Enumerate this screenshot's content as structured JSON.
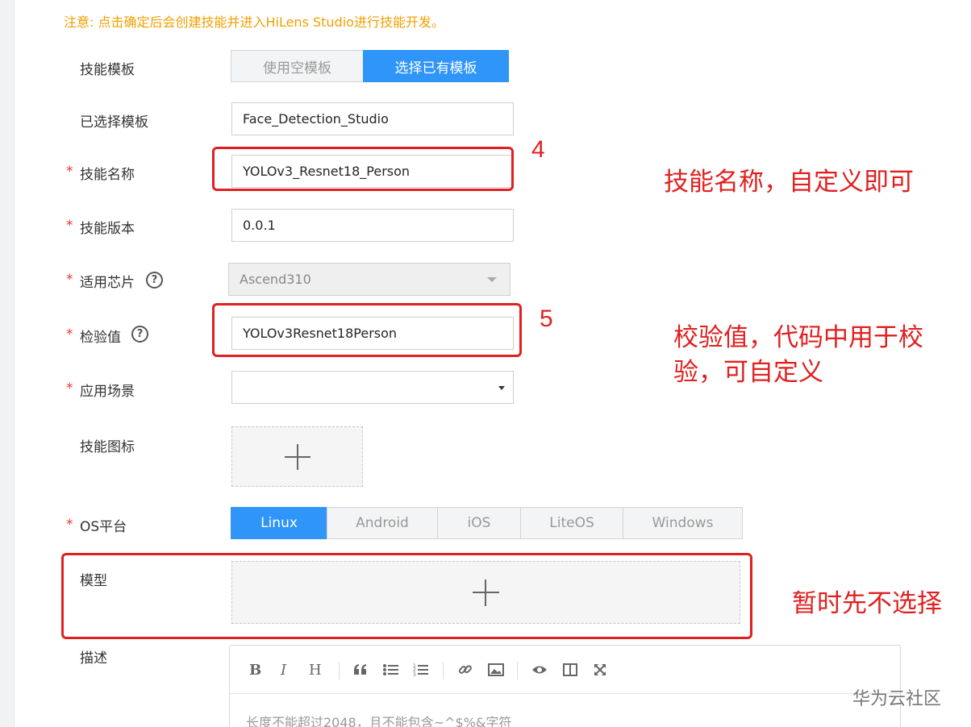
{
  "notice": "注意: 点击确定后会创建技能并进入HiLens Studio进行技能开发。",
  "required_mark": "*",
  "form": {
    "template_label": "技能模板",
    "template_options": [
      "使用空模板",
      "选择已有模板"
    ],
    "template_selected_index": 1,
    "selected_template_label": "已选择模板",
    "selected_template_value": "Face_Detection_Studio",
    "skill_name_label": "技能名称",
    "skill_name_value": "YOLOv3_Resnet18_Person",
    "skill_version_label": "技能版本",
    "skill_version_value": "0.0.1",
    "chip_label": "适用芯片",
    "chip_value": "Ascend310",
    "checksum_label": "检验值",
    "checksum_value": "YOLOv3Resnet18Person",
    "scene_label": "应用场景",
    "scene_value": "",
    "icon_label": "技能图标",
    "os_label": "OS平台",
    "os_options": [
      "Linux",
      "Android",
      "iOS",
      "LiteOS",
      "Windows"
    ],
    "os_selected_index": 0,
    "model_label": "模型",
    "desc_label": "描述",
    "desc_placeholder": "长度不能超过2048，且不能包含~^$%&字符"
  },
  "help_glyph": "?",
  "upload_glyph": "+",
  "toolbar": {
    "bold": "B",
    "italic": "I",
    "heading": "H",
    "icons": [
      "quote-icon",
      "unordered-list-icon",
      "ordered-list-icon",
      "link-icon",
      "image-icon",
      "preview-icon",
      "split-view-icon",
      "fullscreen-icon"
    ]
  },
  "annotations": {
    "step4": "4",
    "step5": "5",
    "note_name": "技能名称，自定义即可",
    "note_checksum_line1": "校验值，代码中用于校",
    "note_checksum_line2": "验，可自定义",
    "note_model": "暂时先不选择"
  },
  "watermark": "华为云社区",
  "colors": {
    "accent": "#2f95f8",
    "annotation_red": "#e02020",
    "notice": "#f0a000",
    "required": "#e33333"
  }
}
